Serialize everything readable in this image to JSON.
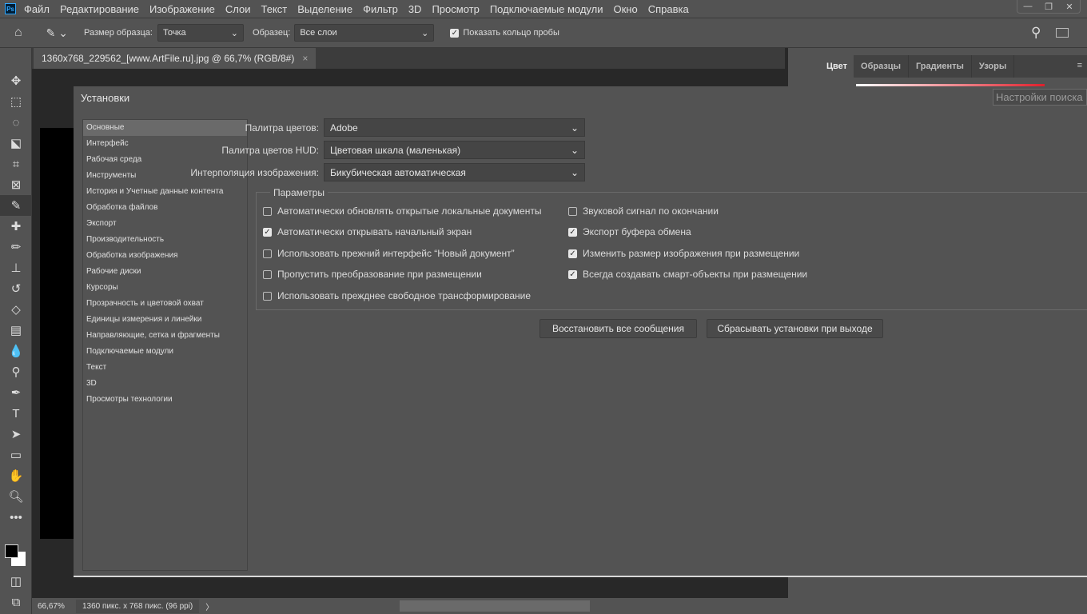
{
  "app": {
    "logo": "Ps",
    "menu": [
      "Файл",
      "Редактирование",
      "Изображение",
      "Слои",
      "Текст",
      "Выделение",
      "Фильтр",
      "3D",
      "Просмотр",
      "Подключаемые модули",
      "Окно",
      "Справка"
    ]
  },
  "options": {
    "sample_size_label": "Размер образца:",
    "sample_size_value": "Точка",
    "sample_label": "Образец:",
    "sample_value": "Все слои",
    "show_ring_label": "Показать кольцо пробы",
    "show_ring_checked": true
  },
  "document_tab": {
    "title": "1360x768_229562_[www.ArtFile.ru].jpg @ 66,7% (RGB/8#)",
    "close": "×"
  },
  "right_panel": {
    "tabs": [
      "Цвет",
      "Образцы",
      "Градиенты",
      "Узоры"
    ],
    "active": "Цвет"
  },
  "dialog": {
    "title": "Установки",
    "search_placeholder": "Настройки поиска",
    "categories": [
      "Основные",
      "Интерфейс",
      "Рабочая среда",
      "Инструменты",
      "История и Учетные данные контента",
      "Обработка файлов",
      "Экспорт",
      "Производительность",
      "Обработка изображения",
      "Рабочие диски",
      "Курсоры",
      "Прозрачность и цветовой охват",
      "Единицы измерения и линейки",
      "Направляющие, сетка и фрагменты",
      "Подключаемые модули",
      "Текст",
      "3D",
      "Просмотры технологии"
    ],
    "selected_category": "Основные",
    "fields": [
      {
        "label": "Палитра цветов:",
        "value": "Adobe"
      },
      {
        "label": "Палитра цветов HUD:",
        "value": "Цветовая шкала (маленькая)"
      },
      {
        "label": "Интерполяция изображения:",
        "value": "Бикубическая автоматическая"
      }
    ],
    "params_title": "Параметры",
    "options_left": [
      {
        "label": "Автоматически обновлять открытые локальные документы",
        "checked": false
      },
      {
        "label": "Автоматически открывать начальный экран",
        "checked": true
      },
      {
        "label": "Использовать прежний интерфейс “Новый документ”",
        "checked": false
      },
      {
        "label": "Пропустить преобразование при размещении",
        "checked": false
      },
      {
        "label": "Использовать прежднее свободное трансформирование",
        "checked": false
      }
    ],
    "options_right": [
      {
        "label": "Звуковой сигнал по окончании",
        "checked": false
      },
      {
        "label": "Экспорт буфера обмена",
        "checked": true
      },
      {
        "label": "Изменить размер изображения при размещении",
        "checked": true
      },
      {
        "label": "Всегда создавать смарт-объекты при размещении",
        "checked": true
      }
    ],
    "buttons": {
      "restore": "Восстановить все сообщения",
      "reset": "Сбрасывать установки при выходе"
    }
  },
  "status": {
    "zoom": "66,67%",
    "info": "1360 пикс. x 768 пикс. (96 ppi)"
  }
}
